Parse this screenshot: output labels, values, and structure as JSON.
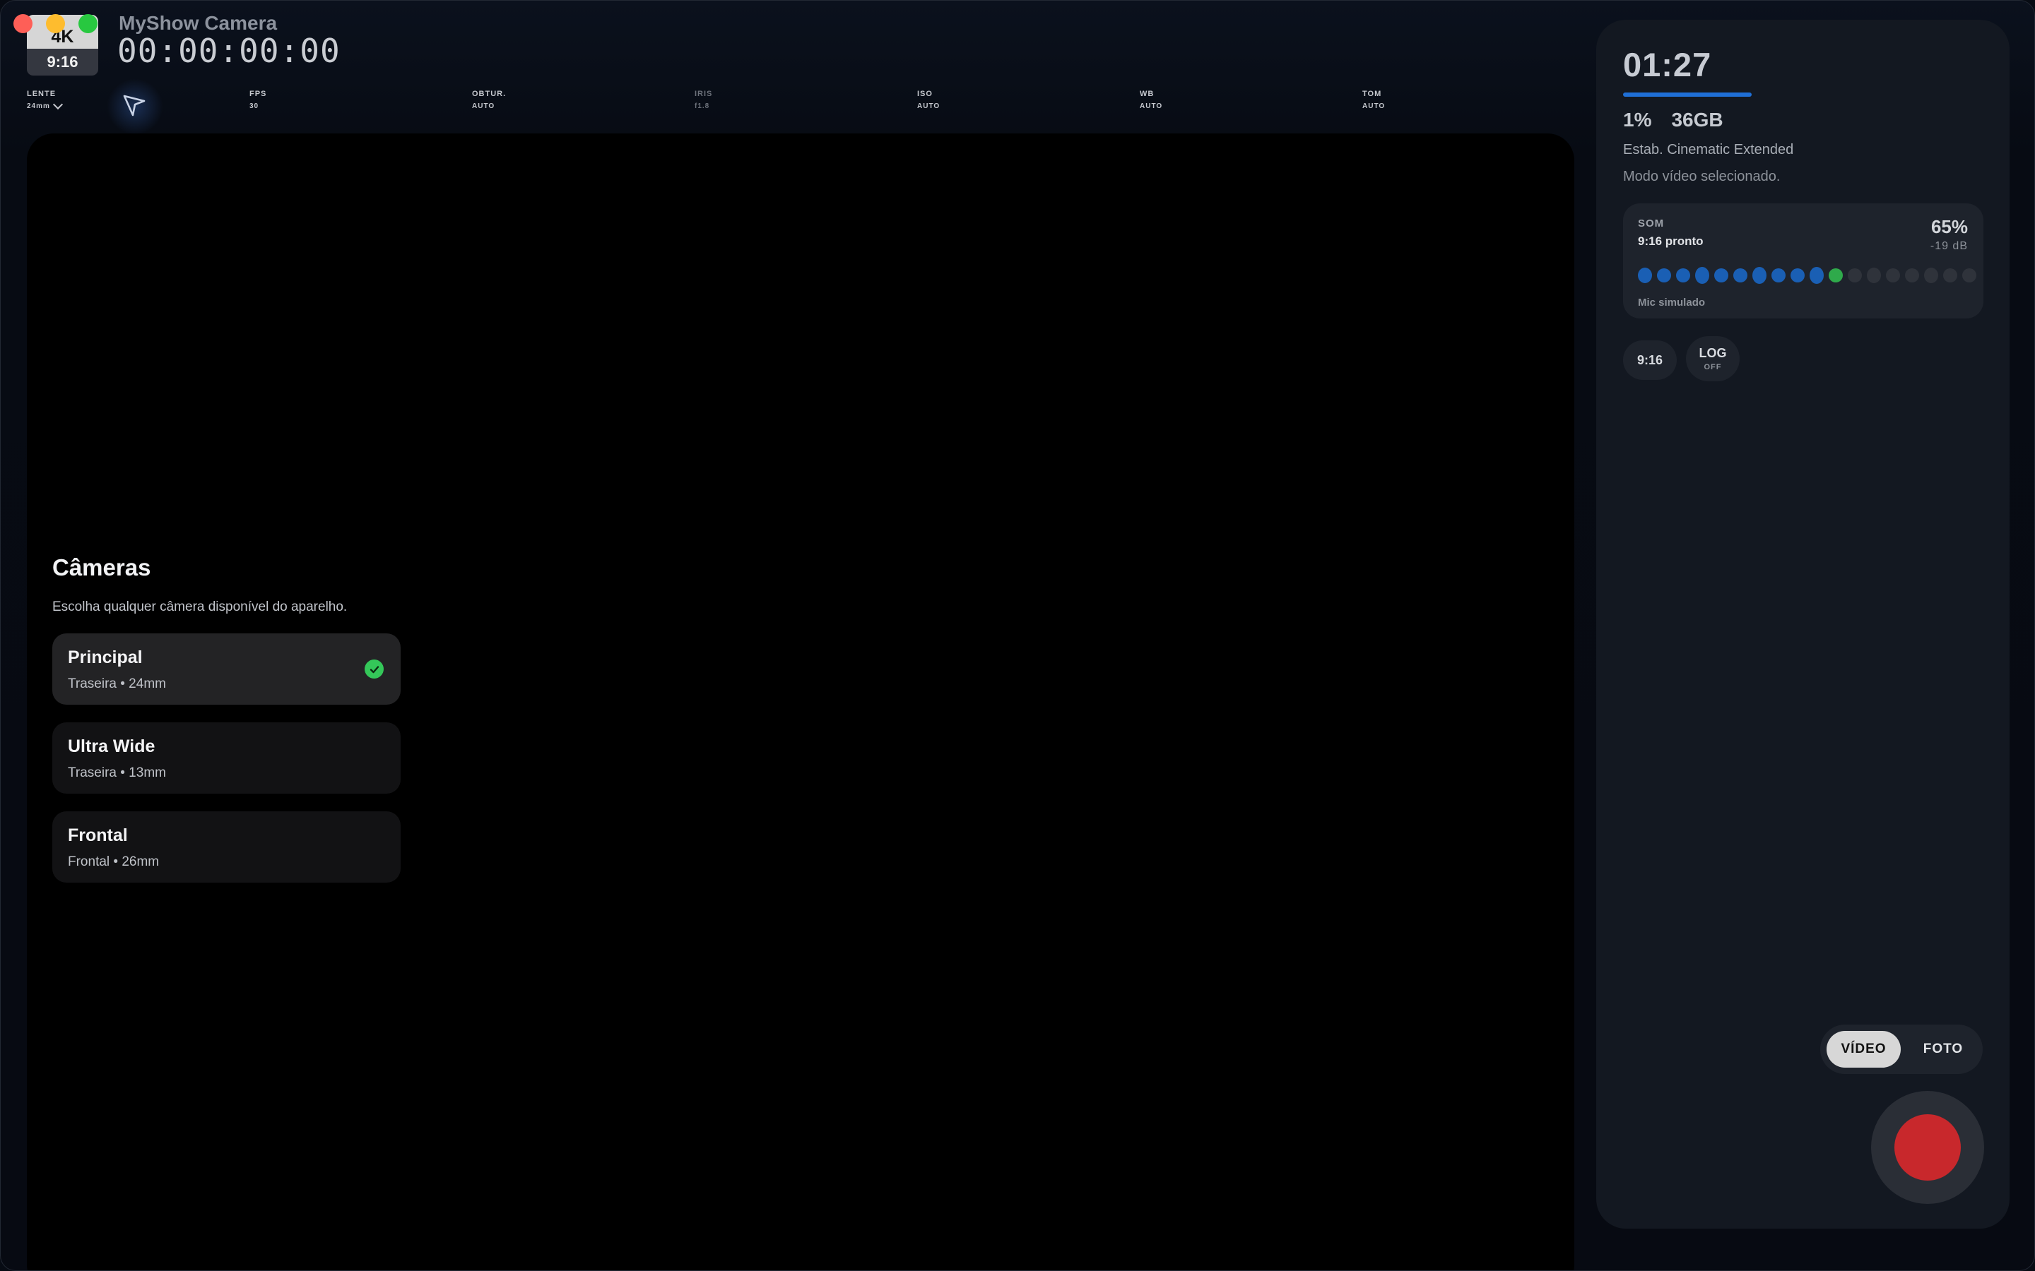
{
  "window": {
    "title": "MyShow Camera"
  },
  "badge": {
    "resolution": "4K",
    "ratio": "9:16"
  },
  "timecode": "00:00:00:00",
  "params": [
    {
      "label": "LENTE",
      "value": "24mm",
      "dropdown": true
    },
    {
      "label": "FPS",
      "value": "30"
    },
    {
      "label": "OBTUR.",
      "value": "AUTO"
    },
    {
      "label": "IRIS",
      "value": "f1.8",
      "dimmed": true
    },
    {
      "label": "ISO",
      "value": "AUTO"
    },
    {
      "label": "WB",
      "value": "AUTO"
    },
    {
      "label": "TOM",
      "value": "AUTO"
    }
  ],
  "cameras": {
    "title": "Câmeras",
    "subtitle": "Escolha qualquer câmera disponível do aparelho.",
    "items": [
      {
        "name": "Principal",
        "detail": "Traseira • 24mm",
        "selected": true
      },
      {
        "name": "Ultra Wide",
        "detail": "Traseira • 13mm",
        "selected": false
      },
      {
        "name": "Frontal",
        "detail": "Frontal • 26mm",
        "selected": false
      }
    ]
  },
  "panel": {
    "remaining_time": "01:27",
    "storage_percent": "1%",
    "storage_free": "36GB",
    "stabilization": "Estab. Cinematic Extended",
    "mode_message": "Modo vídeo selecionado.",
    "sound": {
      "label": "SOM",
      "status": "9:16 pronto",
      "level": "65%",
      "db": "-19 dB",
      "source": "Mic simulado",
      "meter_segments": 18,
      "meter_active": 11
    },
    "chips": {
      "ratio": "9:16",
      "log_label": "LOG",
      "log_state": "OFF"
    },
    "mode": {
      "video": "VÍDEO",
      "photo": "FOTO",
      "active": "video"
    }
  },
  "colors": {
    "accent_blue": "#1f6fd6",
    "meter_peak": "#2faa4b",
    "record_red": "#c8282c",
    "selected_check": "#34c759"
  }
}
